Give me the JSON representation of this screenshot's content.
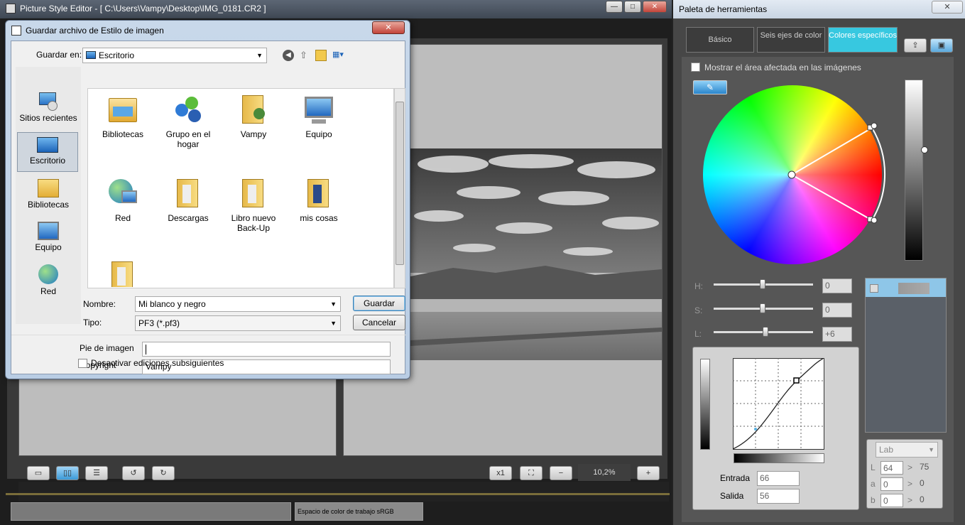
{
  "main": {
    "title": "Picture Style Editor - [ C:\\Users\\Vampy\\Desktop\\IMG_0181.CR2 ]",
    "minimize": "—",
    "maximize": "□",
    "close": "✕",
    "bottom_buttons": [
      "x1",
      "fit",
      "zoom-out",
      "zoom-in"
    ],
    "zoom": "10,2%",
    "status_colorspace": "Espacio de color de trabajo sRGB"
  },
  "palette": {
    "title": "Paleta de herramientas",
    "close": "✕",
    "tabs": [
      {
        "label": "Básico"
      },
      {
        "label": "Seis ejes de color"
      },
      {
        "label": "Colores específicos"
      }
    ],
    "show_affected_label": "Mostrar el área afectada en las imágenes",
    "h_label": "H:",
    "h_value": "0",
    "s_label": "S:",
    "s_value": "0",
    "l_label": "L:",
    "l_value": "+6",
    "entrada_label": "Entrada",
    "entrada_value": "66",
    "salida_label": "Salida",
    "salida_value": "56",
    "lab_select": "Lab",
    "lab_L_label": "L",
    "lab_L_in": "64",
    "lab_L_out": "75",
    "lab_a_label": "a",
    "lab_a_in": "0",
    "lab_a_out": "0",
    "lab_b_label": "b",
    "lab_b_in": "0",
    "lab_b_out": "0",
    "arrow": ">"
  },
  "dialog": {
    "title": "Guardar archivo de Estilo de imagen",
    "close": "✕",
    "save_in_label": "Guardar en:",
    "save_in_value": "Escritorio",
    "nav": [
      {
        "label": "Sitios recientes"
      },
      {
        "label": "Escritorio"
      },
      {
        "label": "Bibliotecas"
      },
      {
        "label": "Equipo"
      },
      {
        "label": "Red"
      }
    ],
    "files": [
      {
        "label": "Bibliotecas",
        "icon": "libraries-icon"
      },
      {
        "label": "Grupo en el hogar",
        "icon": "homegroup-icon"
      },
      {
        "label": "Vampy",
        "icon": "user-folder-icon"
      },
      {
        "label": "Equipo",
        "icon": "computer-icon"
      },
      {
        "label": "Red",
        "icon": "network-icon"
      },
      {
        "label": "Descargas",
        "icon": "folder-icon"
      },
      {
        "label": "Libro nuevo Back-Up",
        "icon": "folder-icon"
      },
      {
        "label": "mis cosas",
        "icon": "folder-icon"
      },
      {
        "label": "",
        "icon": "folder-icon"
      }
    ],
    "name_label": "Nombre:",
    "name_value": "Mi blanco y negro",
    "type_label": "Tipo:",
    "type_value": "PF3 (*.pf3)",
    "save_button": "Guardar",
    "cancel_button": "Cancelar",
    "caption_label": "Pie de imagen",
    "caption_value": "",
    "copyright_label": "Copyright",
    "copyright_value": "Vampy",
    "disable_label": "Desactivar ediciones subsiguientes"
  }
}
